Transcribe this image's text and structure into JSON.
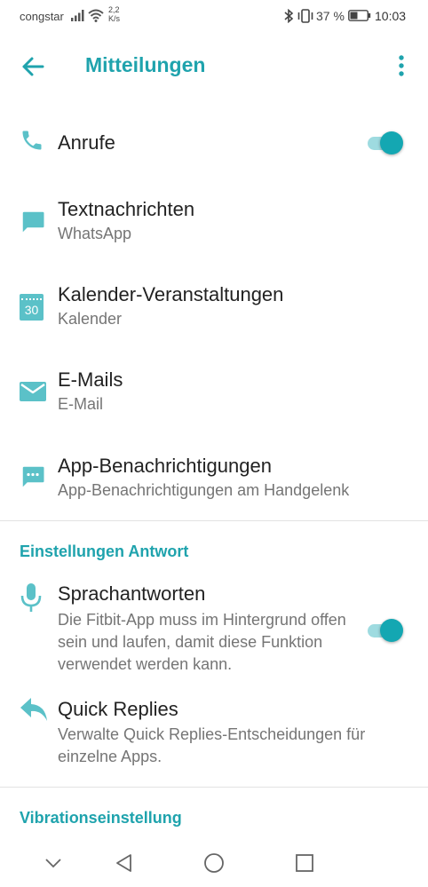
{
  "status_bar": {
    "carrier": "congstar",
    "speed_value": "2,2",
    "speed_unit": "K/s",
    "battery_percent": "37 %",
    "time": "10:03",
    "icons": [
      "signal-icon",
      "wifi-icon",
      "bluetooth-icon",
      "vibrate-icon",
      "battery-icon"
    ]
  },
  "app_bar": {
    "title": "Mitteilungen",
    "back_icon": "arrow-back-icon",
    "menu_icon": "more-vert-icon"
  },
  "notifications": [
    {
      "title": "Anrufe",
      "subtitle": "",
      "icon": "phone-icon",
      "toggle_on": true
    },
    {
      "title": "Textnachrichten",
      "subtitle": "WhatsApp",
      "icon": "message-icon"
    },
    {
      "title": "Kalender-Veranstaltungen",
      "subtitle": "Kalender",
      "icon": "calendar-icon",
      "icon_text": "30"
    },
    {
      "title": "E-Mails",
      "subtitle": "E-Mail",
      "icon": "mail-icon"
    },
    {
      "title": "App-Benachrichtigungen",
      "subtitle": "App-Benachrichtigungen am Handgelenk",
      "icon": "chat-dots-icon"
    }
  ],
  "reply_section": {
    "header": "Einstellungen Antwort",
    "items": [
      {
        "title": "Sprachantworten",
        "subtitle": "Die Fitbit-App muss im Hintergrund offen sein und laufen, damit diese Funktion verwendet werden kann.",
        "icon": "microphone-icon",
        "toggle_on": true
      },
      {
        "title": "Quick Replies",
        "subtitle": "Verwalte Quick Replies-Entscheidungen für einzelne Apps.",
        "icon": "reply-icon"
      }
    ]
  },
  "vibration_section": {
    "header": "Vibrationseinstellung"
  },
  "nav_bar": {
    "icons": [
      "chevron-down-icon",
      "back-triangle-icon",
      "home-circle-icon",
      "recents-square-icon"
    ]
  },
  "colors": {
    "accent": "#1fa3ad",
    "icon": "#5bc1c8",
    "toggle_thumb": "#14a7b2",
    "toggle_track": "#9edbe0"
  }
}
